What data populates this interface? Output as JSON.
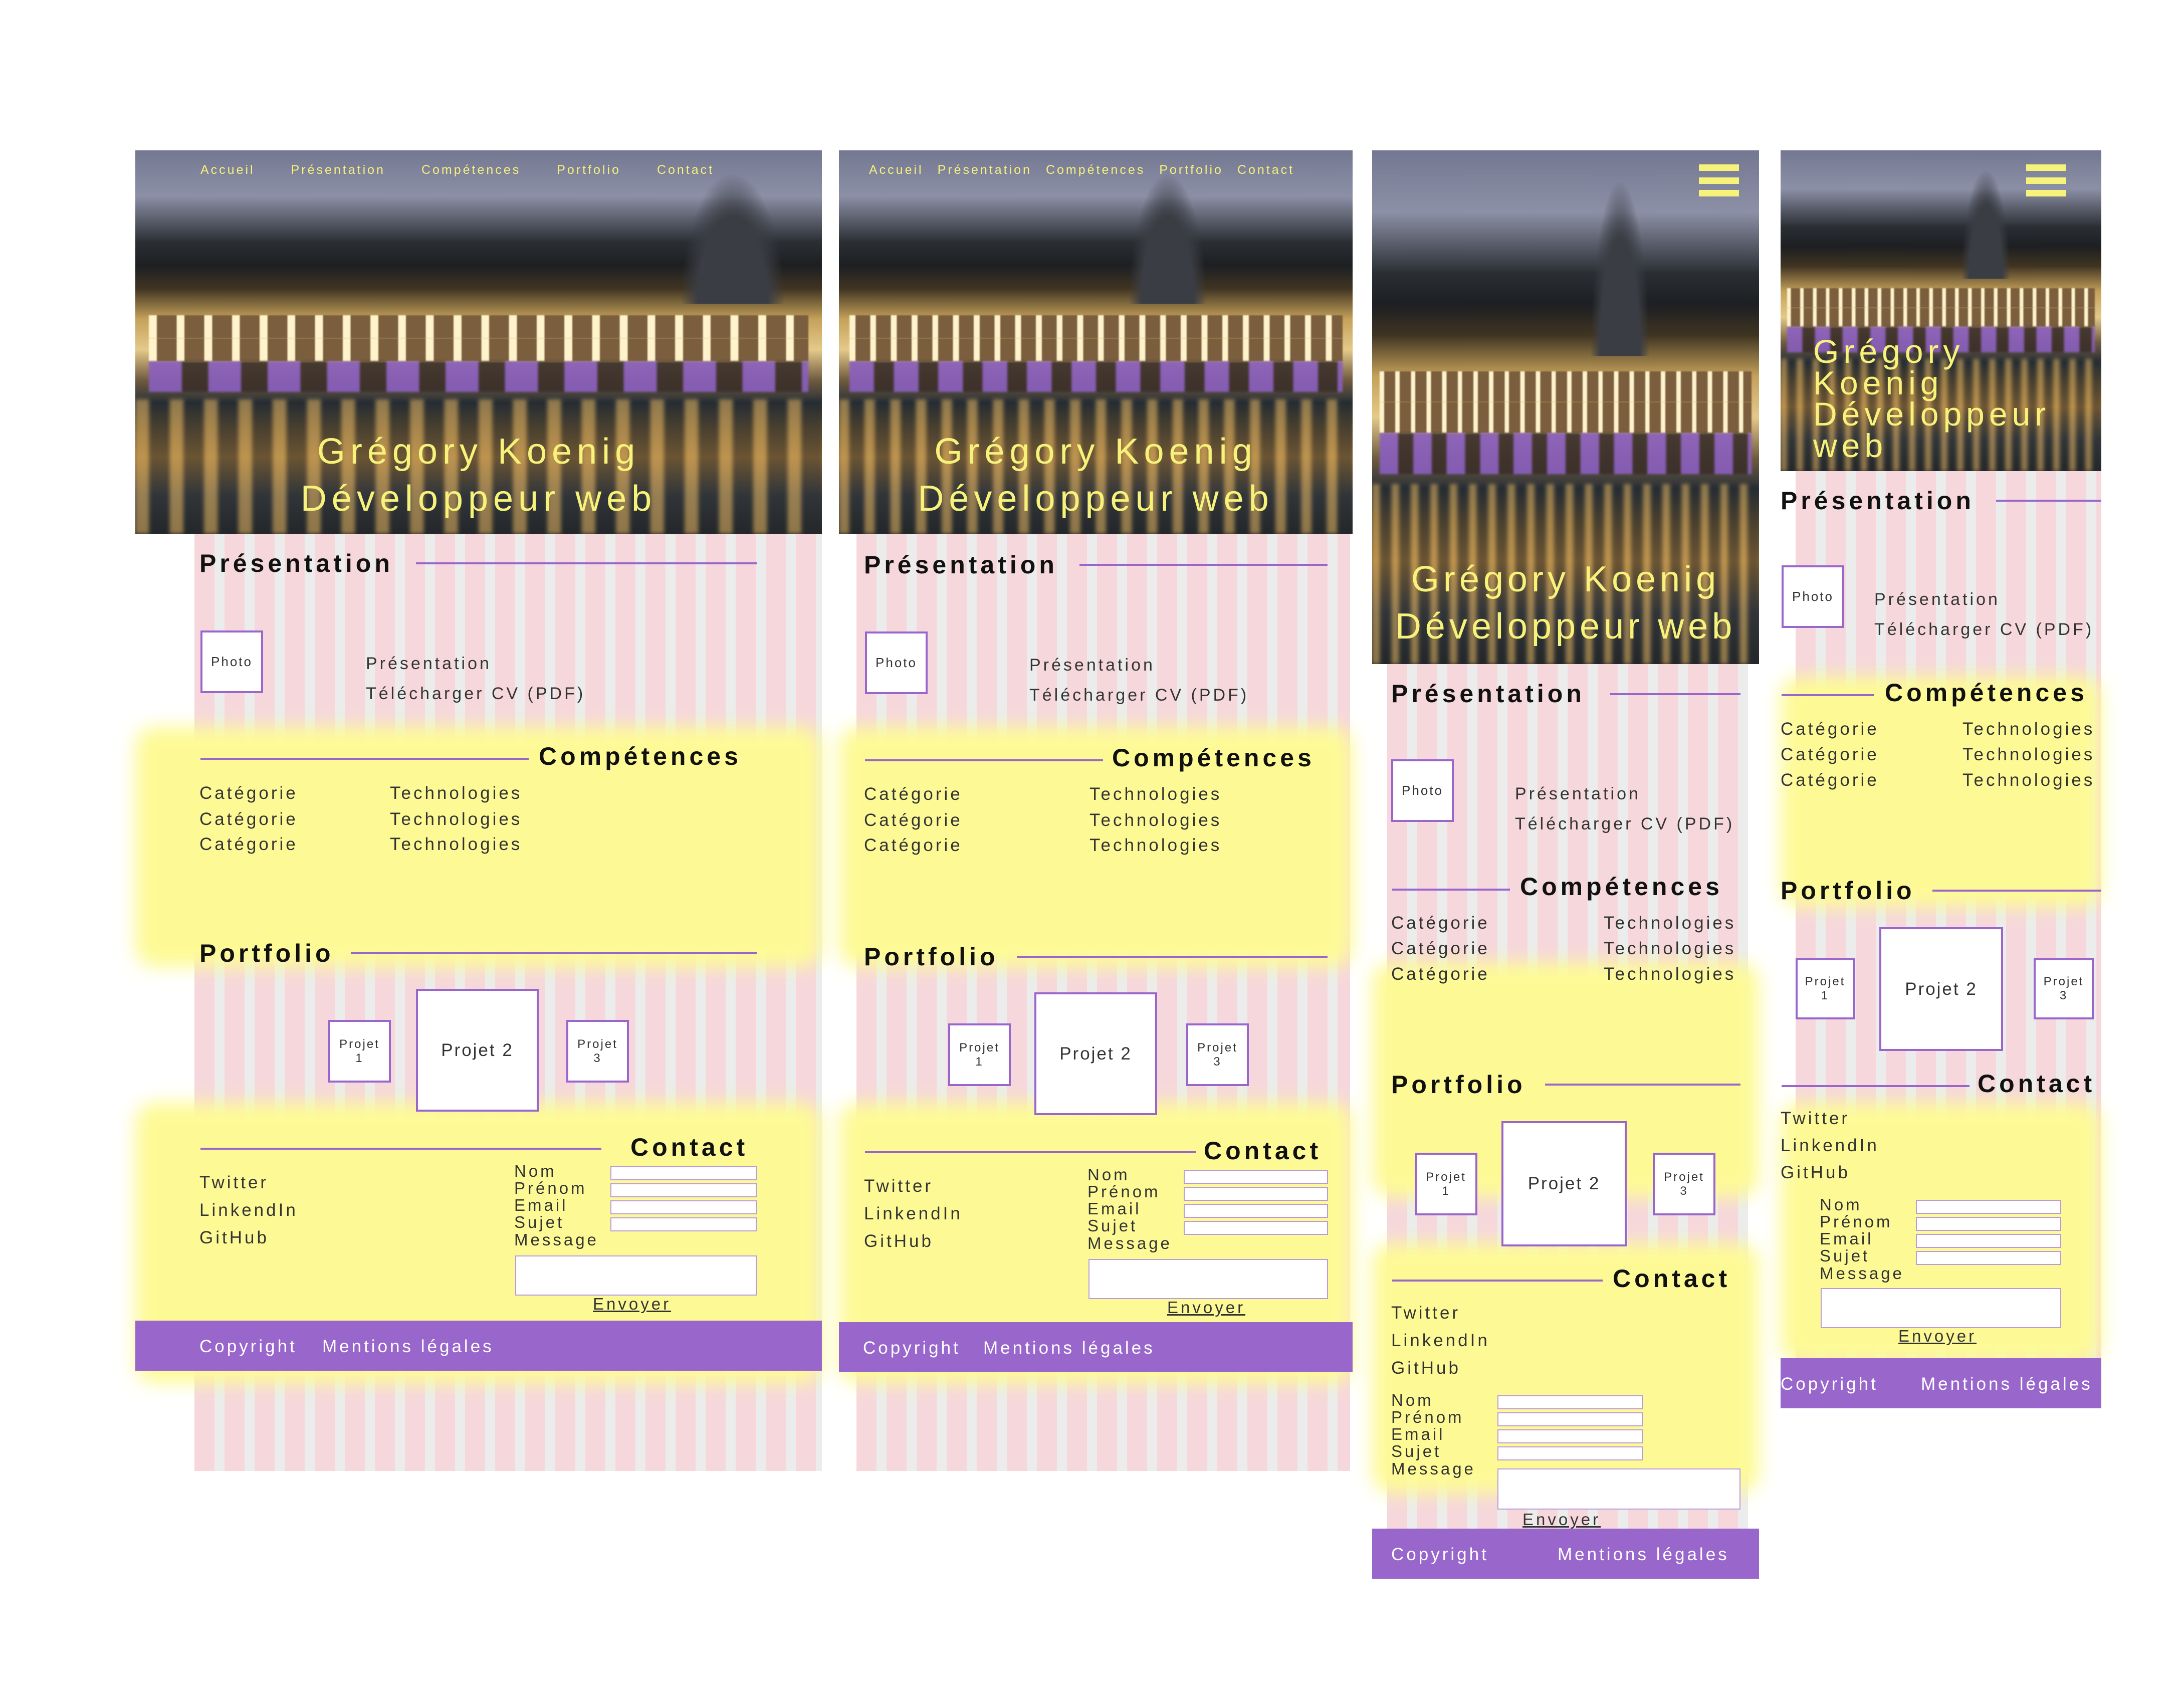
{
  "colors": {
    "accent": "#9966cc",
    "nav_text": "#f7f27a",
    "highlight": "#fdfa96",
    "stripe_pink": "#f6d8dc",
    "stripe_gray": "#ececec"
  },
  "icons": {
    "menu": "hamburger-menu-icon"
  },
  "nav": {
    "home": "Accueil",
    "presentation": "Présentation",
    "skills": "Compétences",
    "portfolio": "Portfolio",
    "contact": "Contact"
  },
  "hero": {
    "name": "Grégory Koenig",
    "role": "Développeur web",
    "name_first": "Grégory",
    "name_last": "Koenig",
    "role_first": "Développeur",
    "role_last": "web"
  },
  "presentation": {
    "title": "Présentation",
    "photo": "Photo",
    "text": "Présentation",
    "cv": "Télécharger CV (PDF)"
  },
  "skills": {
    "title": "Compétences",
    "rows": [
      {
        "category": "Catégorie",
        "tech": "Technologies"
      },
      {
        "category": "Catégorie",
        "tech": "Technologies"
      },
      {
        "category": "Catégorie",
        "tech": "Technologies"
      }
    ]
  },
  "portfolio": {
    "title": "Portfolio",
    "p1": "Projet",
    "p1n": "1",
    "p2": "Projet 2",
    "p3": "Projet",
    "p3n": "3"
  },
  "contact": {
    "title": "Contact",
    "links": [
      "Twitter",
      "LinkendIn",
      "GitHub"
    ],
    "fields": [
      "Nom",
      "Prénom",
      "Email",
      "Sujet",
      "Message"
    ],
    "submit": "Envoyer"
  },
  "footer": {
    "copyright": "Copyright",
    "legal": "Mentions légales"
  }
}
